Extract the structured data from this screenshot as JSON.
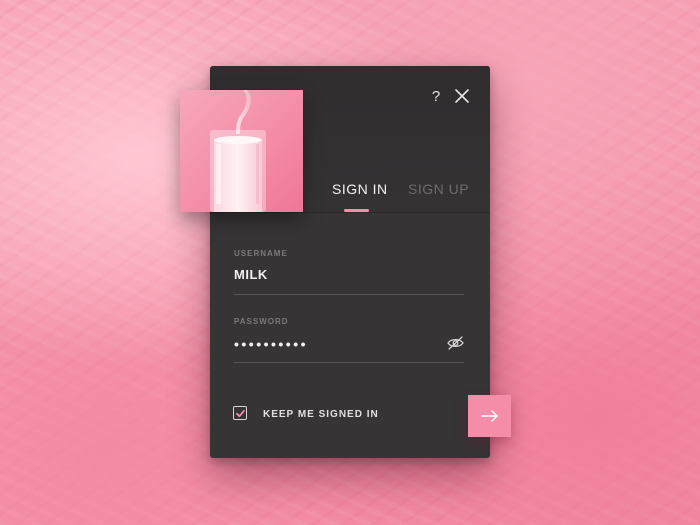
{
  "window": {
    "help_label": "?",
    "close_icon": "close-icon"
  },
  "tabs": [
    {
      "label": "SIGN IN",
      "active": true
    },
    {
      "label": "SIGN UP",
      "active": false
    }
  ],
  "form": {
    "username": {
      "label": "USERNAME",
      "value": "MILK"
    },
    "password": {
      "label": "PASSWORD",
      "value": "••••••••••",
      "toggle_icon": "eye-hidden-icon"
    },
    "keep_signed_in": {
      "label": "KEEP ME SIGNED IN",
      "checked": true
    },
    "submit_icon": "arrow-right-icon"
  },
  "colors": {
    "accent": "#f58ca8",
    "card": "#363435",
    "background": "#f597ad"
  }
}
